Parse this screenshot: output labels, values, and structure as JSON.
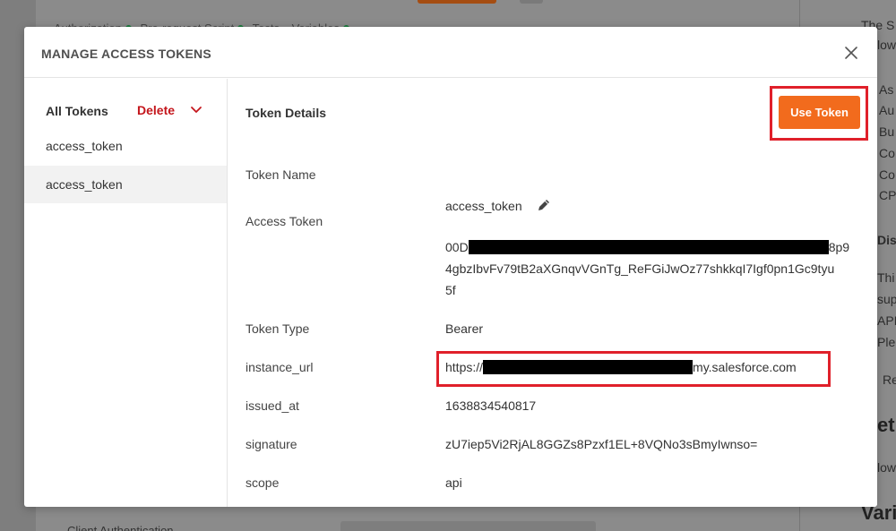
{
  "background": {
    "tabs": "Authorization",
    "tab2": "Pre-request Script",
    "tab3": "Tests",
    "tab4": "Variables",
    "bottom_label": "Client Authentication",
    "right_snippets": [
      "The S",
      "low",
      "As",
      "Au",
      "Bu",
      "Co",
      "Co",
      "CP",
      "Dis",
      "Thi",
      "sup",
      "API",
      "Ple",
      "Re",
      "et",
      "low",
      "Vari"
    ]
  },
  "modal": {
    "title": "MANAGE ACCESS TOKENS",
    "close_icon": "close-icon"
  },
  "sidebar": {
    "header": "All Tokens",
    "delete_label": "Delete",
    "items": [
      {
        "label": "access_token",
        "selected": false
      },
      {
        "label": "access_token",
        "selected": true
      }
    ]
  },
  "details": {
    "title": "Token Details",
    "use_token_label": "Use Token",
    "fields": {
      "token_name": {
        "label": "Token Name",
        "value": "access_token"
      },
      "access_token": {
        "label": "Access Token",
        "prefix": "00D",
        "suffix": "8p9",
        "line2": "4gbzIbvFv79tB2aXGnqvVGnTg_ReFGiJwOz77shkkqI7Igf0pn1Gc9tyu",
        "line3": "5f"
      },
      "token_type": {
        "label": "Token Type",
        "value": "Bearer"
      },
      "instance_url": {
        "label": "instance_url",
        "prefix": "https://",
        "suffix": "my.salesforce.com"
      },
      "issued_at": {
        "label": "issued_at",
        "value": "1638834540817"
      },
      "signature": {
        "label": "signature",
        "value": "zU7iep5Vi2RjAL8GGZs8Pzxf1EL+8VQNo3sBmyIwnso="
      },
      "scope": {
        "label": "scope",
        "value": "api"
      }
    }
  },
  "colors": {
    "accent": "#f26b1d",
    "delete": "#c4161c",
    "highlight": "#e0202a",
    "status_dot": "#1a7a3c"
  }
}
